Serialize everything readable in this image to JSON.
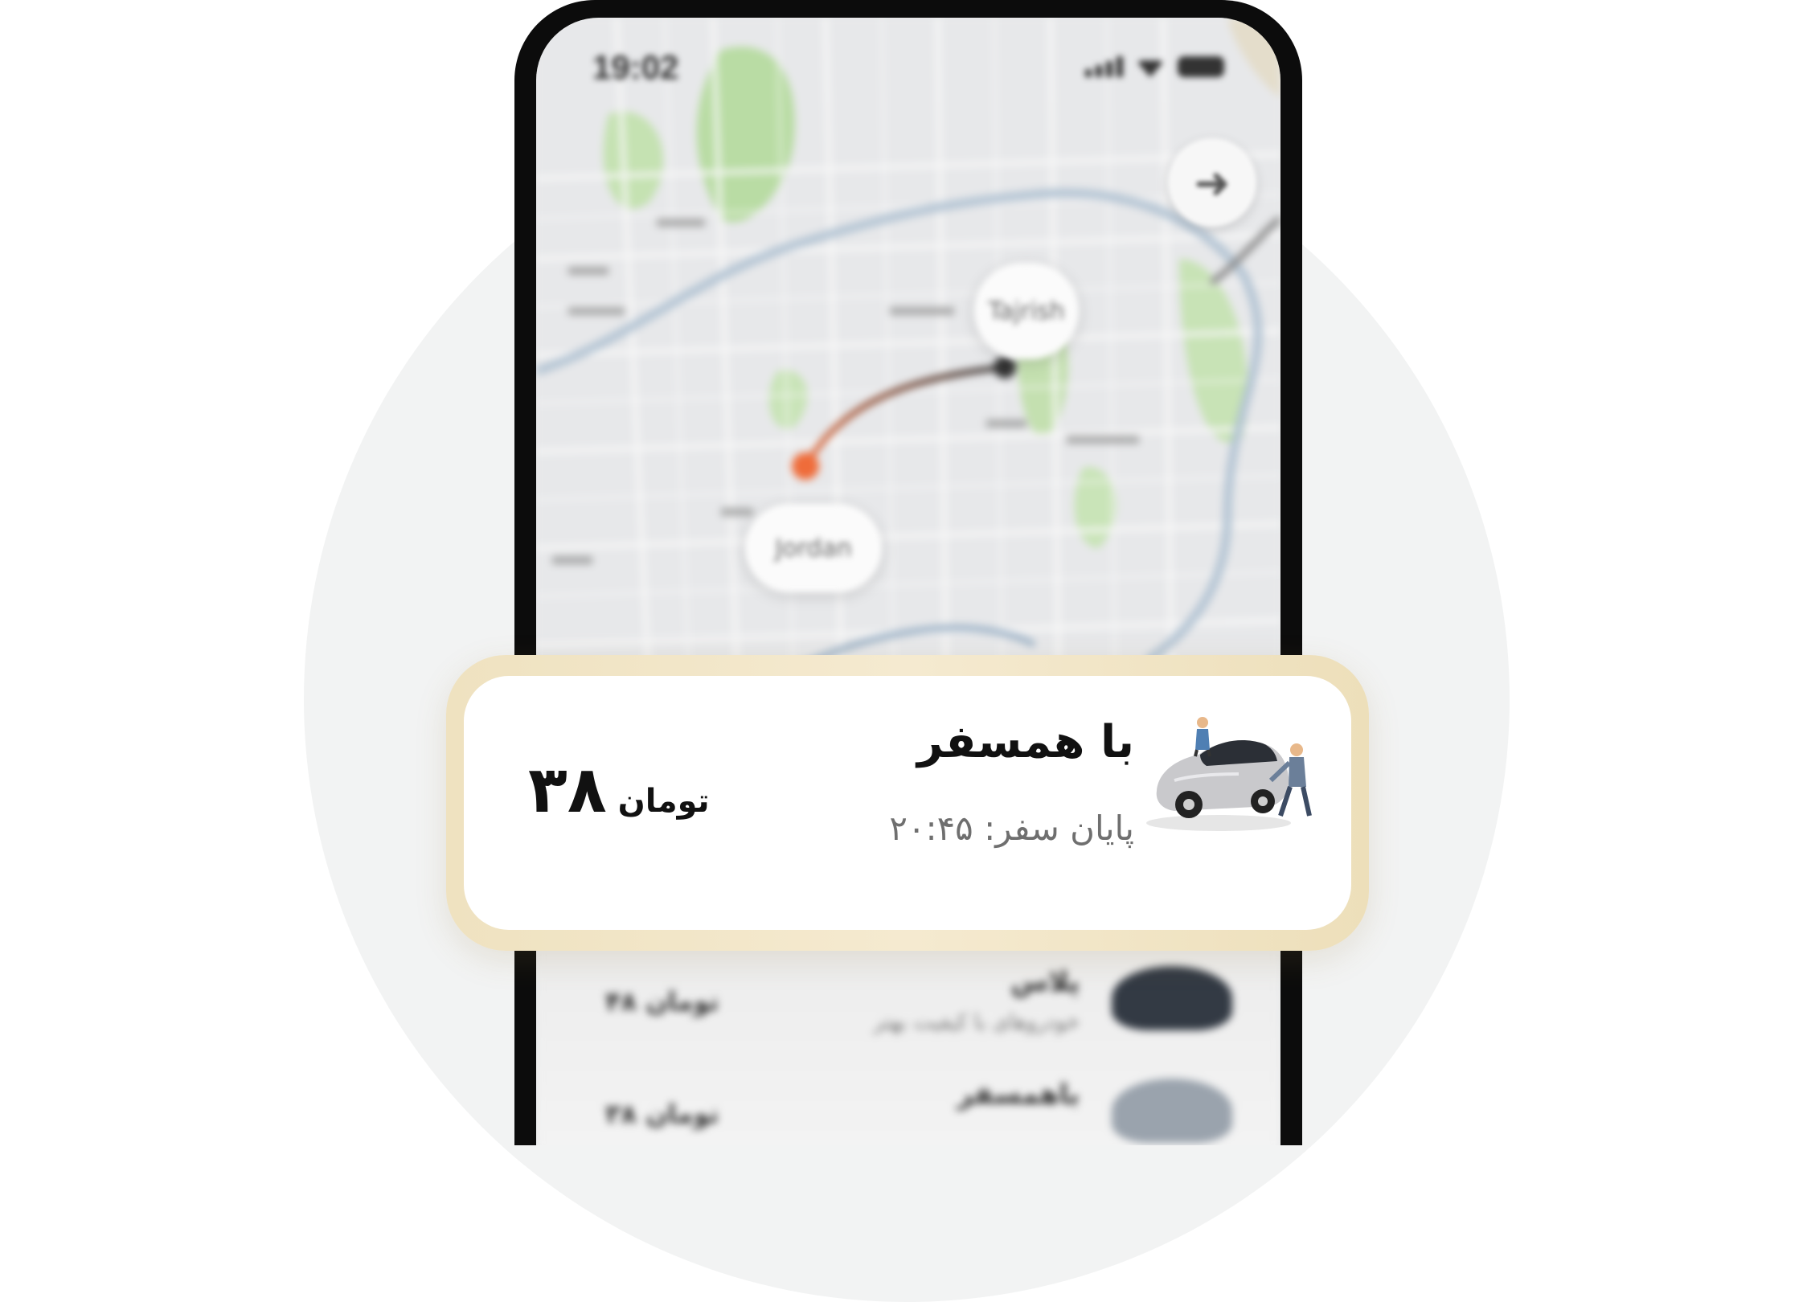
{
  "status_bar": {
    "time": "19:02"
  },
  "map": {
    "destination_label": "Tajrish",
    "origin_label": "Jordan"
  },
  "ride_card": {
    "title": "با همسفر",
    "subtitle": "پایان سفر: ۲۰:۴۵",
    "price_value": "۳۸",
    "price_unit": "تومان"
  },
  "options_list": [
    {
      "title": "پلاس",
      "subtitle": "خودروهای با کیفیت بهتر",
      "price": "۴۸ تومان"
    },
    {
      "title": "باهمسفر",
      "subtitle": "",
      "price": "۳۸ تومان"
    }
  ],
  "colors": {
    "card_frame": "#f3e6c6",
    "route_start": "#ef6c3a",
    "route_end": "#333333",
    "background_circle": "#f2f3f3"
  }
}
